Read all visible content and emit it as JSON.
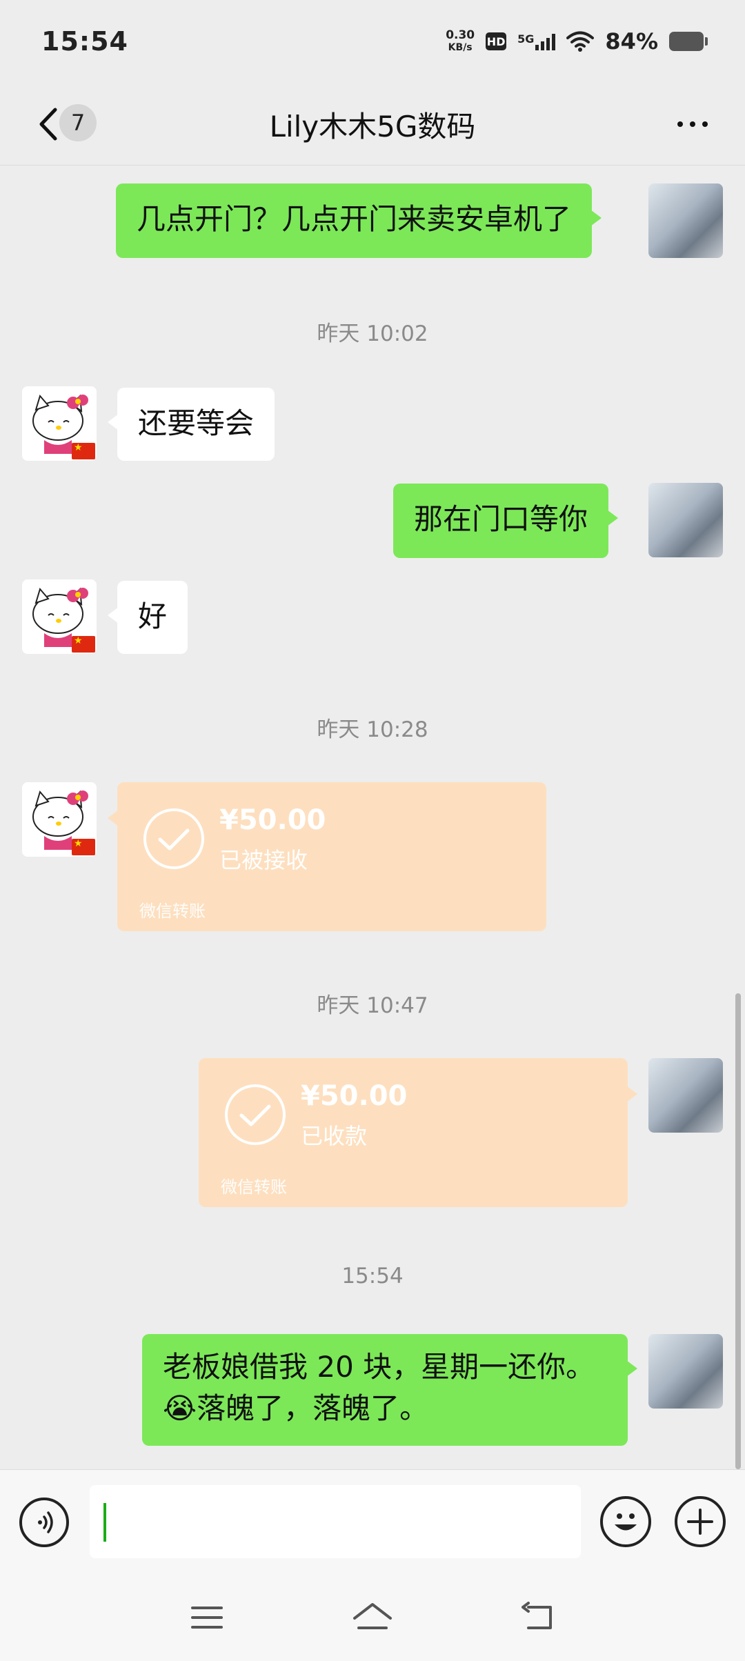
{
  "status_bar": {
    "time": "15:54",
    "net_speed_value": "0.30",
    "net_speed_unit": "KB/s",
    "hd_label": "HD",
    "network": "5G",
    "battery": "84%"
  },
  "header": {
    "back_icon": "chevron-left-icon",
    "unread_count": "7",
    "title": "Lily木木5G数码",
    "more_icon": "more-horizontal-icon"
  },
  "messages": [
    {
      "type": "text",
      "sender": "me",
      "text": "几点开门？几点开门来卖安卓机了"
    },
    {
      "type": "timestamp",
      "text": "昨天 10:02"
    },
    {
      "type": "text",
      "sender": "other",
      "text": "还要等会"
    },
    {
      "type": "text",
      "sender": "me",
      "text": "那在门口等你"
    },
    {
      "type": "text",
      "sender": "other",
      "text": "好"
    },
    {
      "type": "timestamp",
      "text": "昨天 10:28"
    },
    {
      "type": "transfer",
      "sender": "other",
      "amount": "¥50.00",
      "status": "已被接收",
      "label": "微信转账"
    },
    {
      "type": "timestamp",
      "text": "昨天 10:47"
    },
    {
      "type": "transfer",
      "sender": "me",
      "amount": "¥50.00",
      "status": "已收款",
      "label": "微信转账"
    },
    {
      "type": "timestamp",
      "text": "15:54"
    },
    {
      "type": "text",
      "sender": "me",
      "line1": "老板娘借我 20 块，星期一还你。",
      "line2": "落魄了，落魄了。",
      "emoji": "😭"
    }
  ],
  "input": {
    "voice_icon": "voice-icon",
    "value": "",
    "emoji_icon": "smiley-icon",
    "plus_icon": "plus-icon"
  },
  "navbar": {
    "menu_icon": "menu-icon",
    "home_icon": "home-icon",
    "back_icon": "return-icon"
  },
  "colors": {
    "my_bubble": "#7ce858",
    "other_bubble": "#ffffff",
    "transfer": "#fddfbf",
    "background": "#ededed"
  }
}
